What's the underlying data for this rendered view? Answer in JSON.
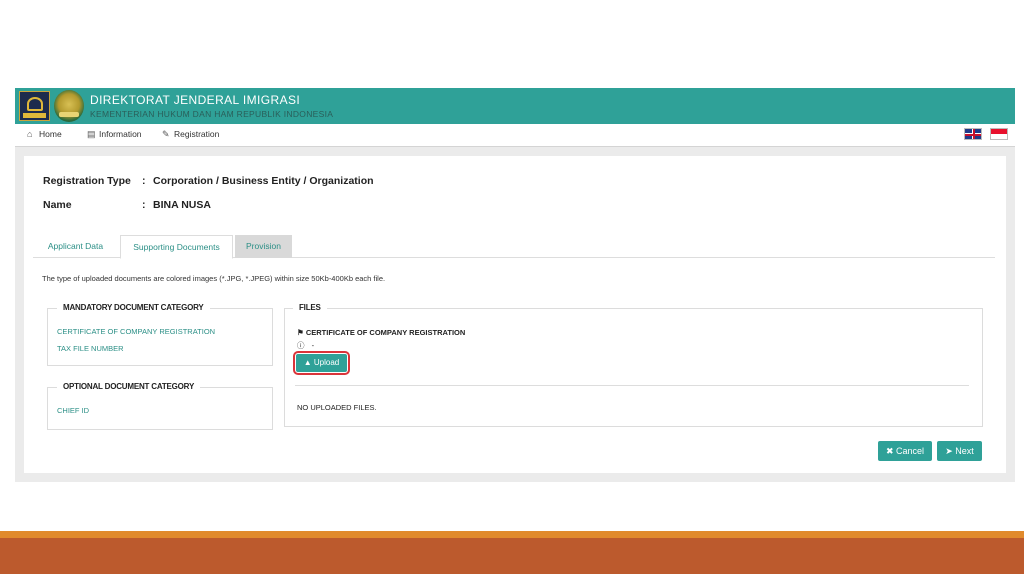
{
  "header": {
    "title": "DIREKTORAT JENDERAL IMIGRASI",
    "subtitle": "KEMENTERIAN HUKUM DAN HAM REPUBLIK INDONESIA"
  },
  "nav": {
    "items": [
      {
        "label": "Home",
        "icon": "home-icon"
      },
      {
        "label": "Information",
        "icon": "book-icon"
      },
      {
        "label": "Registration",
        "icon": "pencil-icon"
      }
    ],
    "languages": [
      "flag-uk-icon",
      "flag-indonesia-icon"
    ]
  },
  "registration": {
    "type_label": "Registration Type",
    "type_value": "Corporation / Business Entity / Organization",
    "name_label": "Name",
    "name_value": "BINA NUSA",
    "separator": ":"
  },
  "tabs": [
    {
      "label": "Applicant Data",
      "state": "normal"
    },
    {
      "label": "Supporting Documents",
      "state": "active"
    },
    {
      "label": "Provision",
      "state": "disabled"
    }
  ],
  "note": "The type of uploaded documents are colored images (*.JPG, *.JPEG) within size 50Kb-400Kb each file.",
  "mandatory": {
    "legend": "MANDATORY DOCUMENT CATEGORY",
    "items": [
      "CERTIFICATE OF COMPANY REGISTRATION",
      "TAX FILE NUMBER"
    ]
  },
  "optional": {
    "legend": "OPTIONAL DOCUMENT CATEGORY",
    "items": [
      "CHIEF ID"
    ]
  },
  "files": {
    "legend": "FILES",
    "selected_title": "CERTIFICATE OF COMPANY REGISTRATION",
    "info": "-",
    "upload_label": "Upload",
    "empty_text": "NO UPLOADED FILES."
  },
  "actions": {
    "cancel_label": "Cancel",
    "next_label": "Next"
  },
  "colors": {
    "brand": "#2fa198",
    "highlight": "#d9343a",
    "slide_bar_orange": "#e18a2c",
    "slide_bar_rust": "#bc5a2d"
  }
}
